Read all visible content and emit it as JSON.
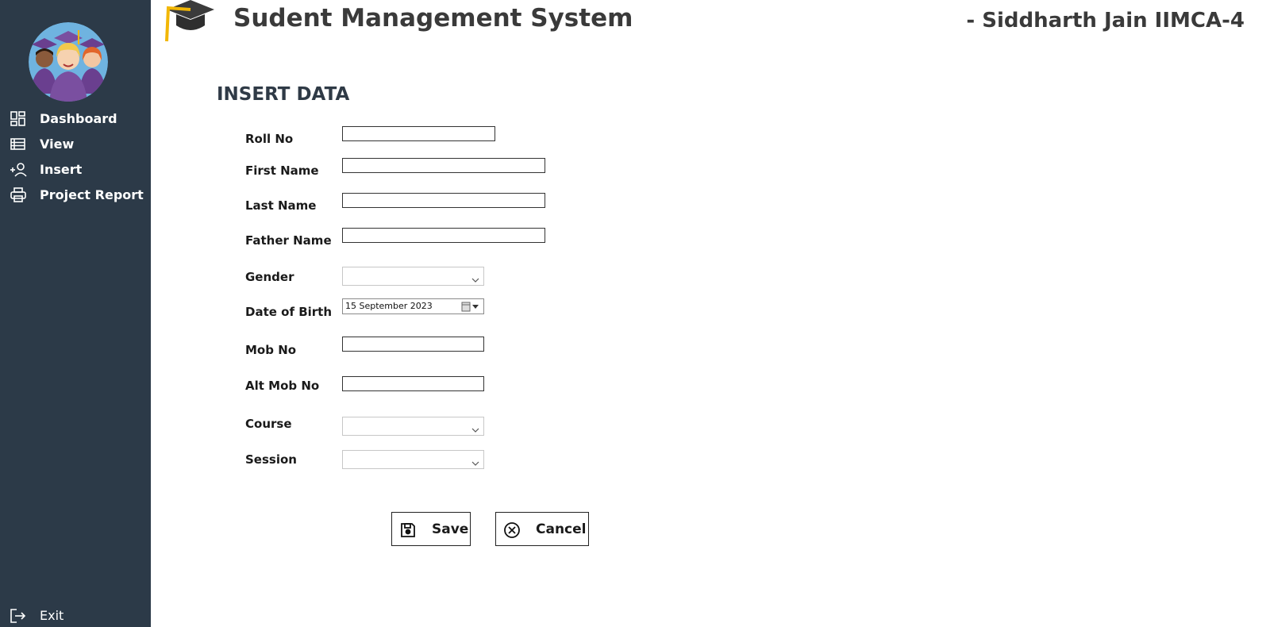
{
  "header": {
    "title": "Sudent Management System",
    "author": "- Siddharth Jain IIMCA-4",
    "logo_icon": "graduation-cap-icon"
  },
  "sidebar": {
    "avatar_icon": "students-avatar",
    "items": [
      {
        "label": "Dashboard",
        "icon": "dashboard-icon"
      },
      {
        "label": "View",
        "icon": "list-icon"
      },
      {
        "label": "Insert",
        "icon": "add-user-icon"
      },
      {
        "label": "Project Report",
        "icon": "printer-icon"
      }
    ],
    "exit": {
      "label": "Exit",
      "icon": "exit-icon"
    }
  },
  "form": {
    "section_title": "INSERT DATA",
    "fields": {
      "roll_no": {
        "label": "Roll No",
        "value": ""
      },
      "first_name": {
        "label": "First Name",
        "value": ""
      },
      "last_name": {
        "label": "Last Name",
        "value": ""
      },
      "father_name": {
        "label": "Father Name",
        "value": ""
      },
      "gender": {
        "label": "Gender",
        "value": ""
      },
      "dob": {
        "label": "Date of Birth",
        "value": "15 September 2023"
      },
      "mob_no": {
        "label": "Mob No",
        "value": ""
      },
      "alt_mob_no": {
        "label": "Alt Mob No",
        "value": ""
      },
      "course": {
        "label": "Course",
        "value": ""
      },
      "session": {
        "label": "Session",
        "value": ""
      }
    },
    "buttons": {
      "save": {
        "label": "Save",
        "icon": "save-icon"
      },
      "cancel": {
        "label": "Cancel",
        "icon": "cancel-icon"
      }
    }
  },
  "colors": {
    "sidebar_bg": "#2c3a48",
    "cap_tassel": "#f2b705",
    "avatar_bg": "#6fb3e0",
    "gown": "#7a4fa0"
  }
}
